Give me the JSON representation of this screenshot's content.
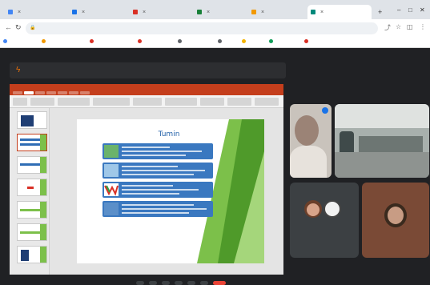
{
  "browser": {
    "tabs": [
      {
        "title": "",
        "favicon_color": "#4285f4"
      },
      {
        "title": "",
        "favicon_color": "#1a73e8"
      },
      {
        "title": "",
        "favicon_color": "#d93025"
      },
      {
        "title": "",
        "favicon_color": "#188038"
      },
      {
        "title": "",
        "favicon_color": "#f29900"
      },
      {
        "title": "",
        "favicon_color": "#00897b",
        "active": true
      }
    ],
    "new_tab_label": "+",
    "window_controls": {
      "minimize": "–",
      "restore": "□",
      "close": "✕"
    },
    "address": "",
    "bookmarks": [
      {
        "label": "",
        "color": "#4285f4"
      },
      {
        "label": "",
        "color": "#f29900"
      },
      {
        "label": "",
        "color": "#d93025"
      },
      {
        "label": "",
        "color": "#d93025"
      },
      {
        "label": "",
        "color": "#5f6368"
      },
      {
        "label": "",
        "color": "#5f6368"
      },
      {
        "label": "",
        "color": "#f4b400"
      },
      {
        "label": "",
        "color": "#0f9d58"
      },
      {
        "label": "",
        "color": "#d93025"
      }
    ],
    "bookmarks_more": ""
  },
  "meeting": {
    "presenting_banner": "",
    "slide": {
      "title": "Tumin",
      "green_lines": [
        "",
        ""
      ],
      "footer_text": ""
    },
    "participants": [
      {
        "name": ""
      },
      {
        "name": ""
      },
      {
        "name": ""
      },
      {
        "name": ""
      }
    ]
  },
  "colors": {
    "meet_background": "#202124",
    "ppt_accent": "#c43e1c",
    "slide_row_blue": "#3a78c0",
    "slide_green": "#7cc04a"
  }
}
